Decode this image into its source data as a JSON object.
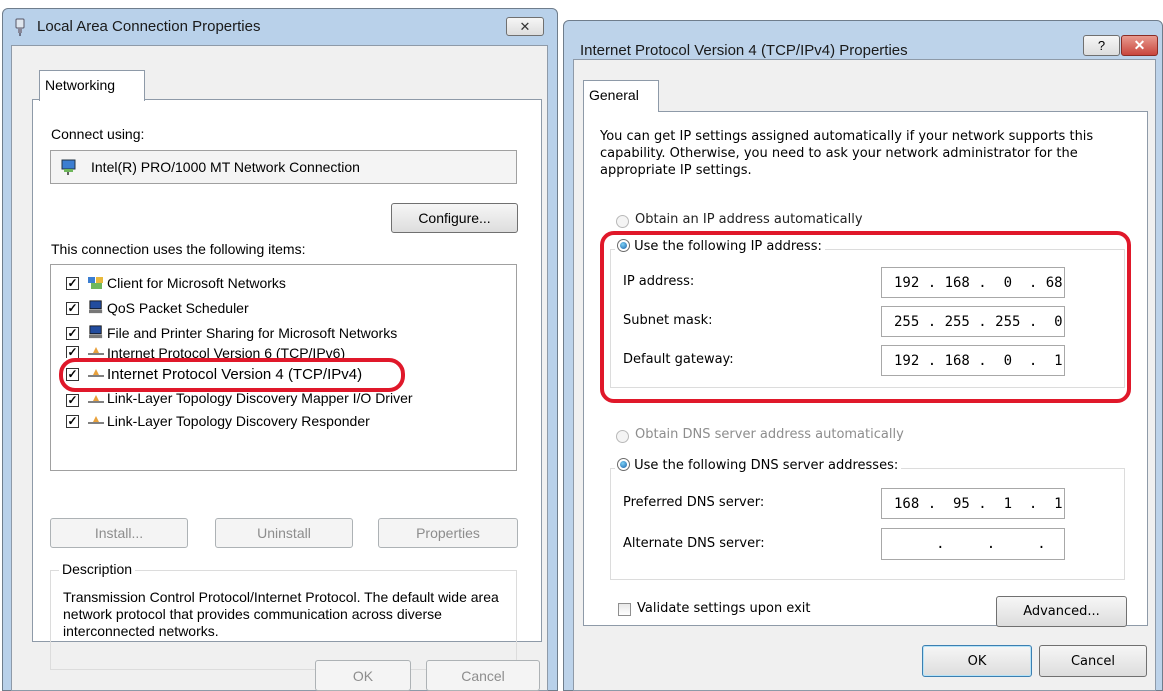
{
  "left_dialog": {
    "title": "Local Area Connection Properties",
    "tab": "Networking",
    "connect_using_label": "Connect using:",
    "adapter": "Intel(R) PRO/1000 MT Network Connection",
    "configure_label": "Configure...",
    "items_label": "This connection uses the following items:",
    "items": [
      {
        "label": "Client for Microsoft Networks",
        "checked": true,
        "icon": "network-client-icon"
      },
      {
        "label": "QoS Packet Scheduler",
        "checked": true,
        "icon": "computer-service-icon"
      },
      {
        "label": "File and Printer Sharing for Microsoft Networks",
        "checked": true,
        "icon": "computer-service-icon"
      },
      {
        "label": "Internet Protocol Version 6 (TCP/IPv6)",
        "checked": true,
        "icon": "protocol-icon"
      },
      {
        "label": "Internet Protocol Version 4 (TCP/IPv4)",
        "checked": true,
        "icon": "protocol-icon",
        "highlighted": true
      },
      {
        "label": "Link-Layer Topology Discovery Mapper I/O Driver",
        "checked": true,
        "icon": "protocol-icon"
      },
      {
        "label": "Link-Layer Topology Discovery Responder",
        "checked": true,
        "icon": "protocol-icon"
      }
    ],
    "install_label": "Install...",
    "uninstall_label": "Uninstall",
    "properties_label": "Properties",
    "description_title": "Description",
    "description_text": "Transmission Control Protocol/Internet Protocol. The default wide area network protocol that provides communication across diverse interconnected networks.",
    "ok_label": "OK",
    "cancel_label": "Cancel"
  },
  "right_dialog": {
    "title": "Internet Protocol Version 4 (TCP/IPv4) Properties",
    "help_glyph": "?",
    "close_glyph": "✕",
    "tab": "General",
    "intro_text": "You can get IP settings assigned automatically if your network supports this capability. Otherwise, you need to ask your network administrator for the appropriate IP settings.",
    "obtain_ip_auto_label": "Obtain an IP address automatically",
    "use_following_ip_label": "Use the following IP address:",
    "ip_address_label": "IP address:",
    "ip_address_value": "192 . 168 .  0  . 68",
    "subnet_mask_label": "Subnet mask:",
    "subnet_mask_value": "255 . 255 . 255 .  0",
    "default_gateway_label": "Default gateway:",
    "default_gateway_value": "192 . 168 .  0  .  1",
    "obtain_dns_auto_label": "Obtain DNS server address automatically",
    "use_following_dns_label": "Use the following DNS server addresses:",
    "preferred_dns_label": "Preferred DNS server:",
    "preferred_dns_value": "168 .  95 .  1  .  1",
    "alternate_dns_label": "Alternate DNS server:",
    "alternate_dns_value": "     .     .     .",
    "validate_label": "Validate settings upon exit",
    "advanced_label": "Advanced...",
    "ok_label": "OK",
    "cancel_label": "Cancel"
  },
  "colors": {
    "highlight_red": "#e0182a",
    "close_button_red": "#c9463d",
    "glass_frame": "#b9d1ea"
  }
}
